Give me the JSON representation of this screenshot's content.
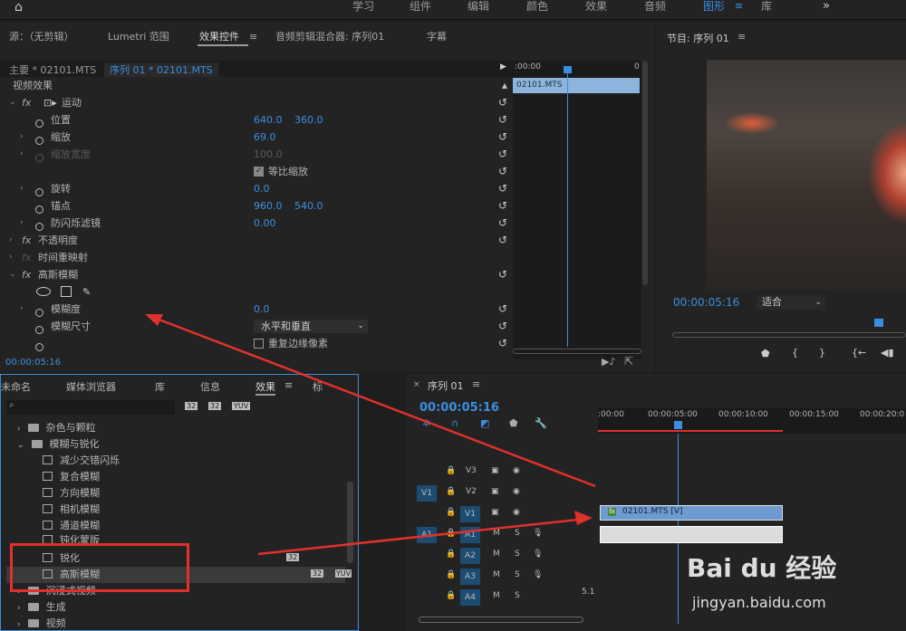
{
  "workspace": {
    "tabs": [
      "学习",
      "组件",
      "编辑",
      "颜色",
      "效果",
      "音频",
      "图形",
      "库"
    ],
    "active": "图形"
  },
  "source_panel": {
    "tabs": [
      "源：（无剪辑）",
      "Lumetri 范围",
      "效果控件",
      "音频剪辑混合器: 序列01",
      "字幕"
    ],
    "master_label": "主要 * 02101.MTS",
    "sequence_label": "序列 01 * 02101.MTS",
    "section_title": "视频效果",
    "motion": {
      "name": "运动",
      "position": {
        "label": "位置",
        "x": "640.0",
        "y": "360.0"
      },
      "scale": {
        "label": "缩放",
        "value": "69.0"
      },
      "scale_width": {
        "label": "缩放宽度",
        "value": "100.0"
      },
      "uniform_scale": "等比缩放",
      "rotation": {
        "label": "旋转",
        "value": "0.0"
      },
      "anchor": {
        "label": "锚点",
        "x": "960.0",
        "y": "540.0"
      },
      "flicker": {
        "label": "防闪烁滤镜",
        "value": "0.00"
      }
    },
    "opacity": "不透明度",
    "time_remap": "时间重映射",
    "gaussian": {
      "name": "高斯模糊",
      "blurriness": {
        "label": "模糊度",
        "value": "0.0"
      },
      "dimension": {
        "label": "模糊尺寸",
        "value": "水平和垂直"
      },
      "repeat_edge": "重复边缘像素"
    },
    "mini_timeline": {
      "start": ":00:00",
      "end": "0",
      "clip": "02101.MTS"
    },
    "timecode": "00:00:05:16"
  },
  "program": {
    "title": "节目: 序列 01",
    "timecode": "00:00:05:16",
    "fit": "适合"
  },
  "effects_panel": {
    "tabs": [
      "未命名",
      "媒体浏览器",
      "库",
      "信息",
      "效果",
      "标"
    ],
    "active_tab": "效果",
    "search_placeholder": "",
    "icons": [
      "32",
      "32",
      "YUV"
    ],
    "tree": [
      {
        "label": "杂色与颗粒",
        "type": "folder",
        "expanded": false
      },
      {
        "label": "模糊与锐化",
        "type": "folder",
        "expanded": true
      },
      {
        "label": "减少交错闪烁",
        "type": "effect"
      },
      {
        "label": "复合模糊",
        "type": "effect"
      },
      {
        "label": "方向模糊",
        "type": "effect"
      },
      {
        "label": "相机模糊",
        "type": "effect"
      },
      {
        "label": "通道模糊",
        "type": "effect"
      },
      {
        "label": "钝化蒙版",
        "type": "effect"
      },
      {
        "label": "锐化",
        "type": "effect"
      },
      {
        "label": "高斯模糊",
        "type": "effect",
        "selected": true
      },
      {
        "label": "沉浸式视频",
        "type": "folder",
        "expanded": false
      },
      {
        "label": "生成",
        "type": "folder",
        "expanded": false
      },
      {
        "label": "视频",
        "type": "folder",
        "expanded": false
      }
    ]
  },
  "timeline": {
    "title": "序列 01",
    "timecode": "00:00:05:16",
    "ruler": [
      ":00:00",
      "00:00:05:00",
      "00:00:10:00",
      "00:00:15:00",
      "00:00:20:0"
    ],
    "tracks": [
      {
        "id": "V3"
      },
      {
        "id": "V2",
        "src": "V1"
      },
      {
        "id": "V1"
      },
      {
        "id": "A1",
        "src": "A1",
        "m": "M",
        "s": "S"
      },
      {
        "id": "A2",
        "m": "M",
        "s": "S"
      },
      {
        "id": "A3",
        "m": "M",
        "s": "S"
      },
      {
        "id": "A4",
        "m": "M",
        "s": "S",
        "ch": "5.1"
      }
    ],
    "video_clip": "02101.MTS [V]"
  },
  "watermark": {
    "brand": "Bai du 经验",
    "url": "jingyan.baidu.com"
  },
  "colors": {
    "accent": "#2d8ceb",
    "annotation": "#e0312b",
    "selection": "#e0312b"
  }
}
